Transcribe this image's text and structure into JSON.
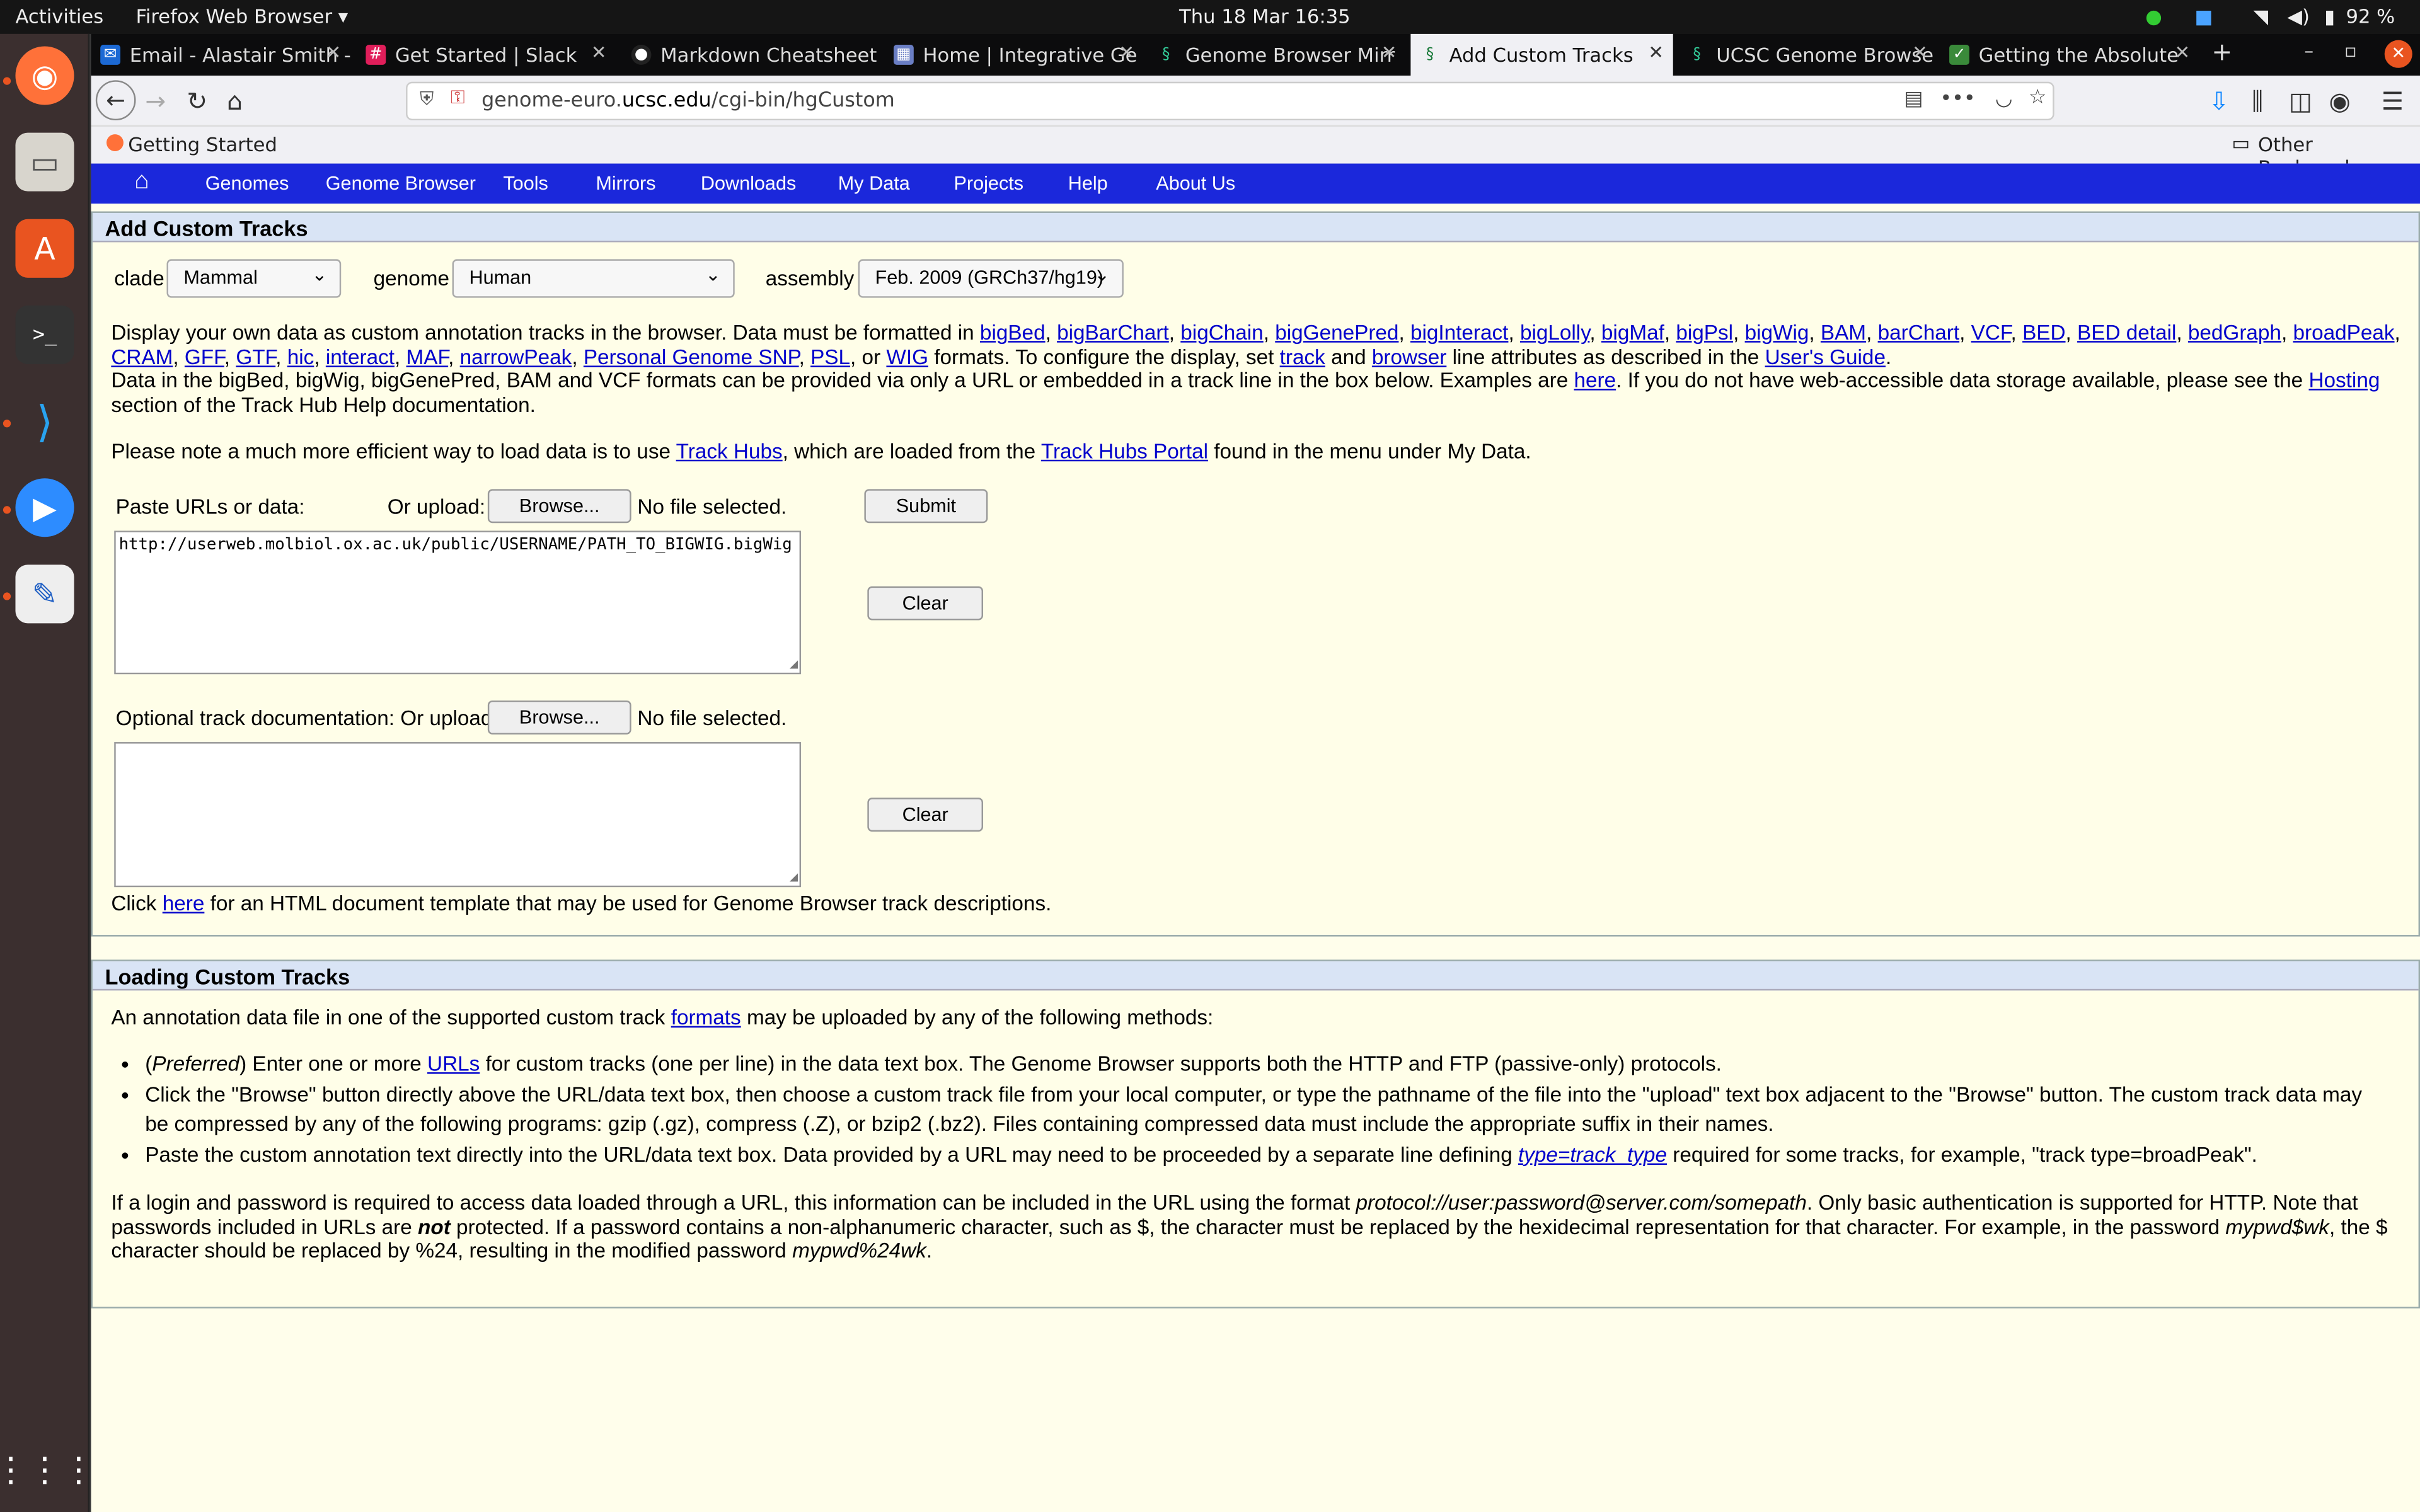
{
  "system": {
    "activities": "Activities",
    "app_menu": "Firefox Web Browser ▾",
    "clock": "Thu 18 Mar  16:35",
    "battery": "92 %"
  },
  "tabs": [
    {
      "label": "Email - Alastair Smith -",
      "icon": "mail-icon"
    },
    {
      "label": "Get Started | Slack",
      "icon": "slack-icon"
    },
    {
      "label": "Markdown Cheatsheet",
      "icon": "github-icon"
    },
    {
      "label": "Home | Integrative Ge",
      "icon": "home-page-icon"
    },
    {
      "label": "Genome Browser Mirr",
      "icon": "ucsc-icon"
    },
    {
      "label": "Add Custom Tracks",
      "icon": "ucsc-icon"
    },
    {
      "label": "UCSC Genome Browse",
      "icon": "ucsc-icon"
    },
    {
      "label": "Getting the Absolute",
      "icon": "page-icon"
    }
  ],
  "browser": {
    "url_host": "genome-euro.",
    "url_domain": "ucsc.edu",
    "url_path": "/cgi-bin/hgCustom",
    "bookmark": "Getting Started",
    "other_bookmarks": "Other Bookmarks"
  },
  "menu": [
    "Genomes",
    "Genome Browser",
    "Tools",
    "Mirrors",
    "Downloads",
    "My Data",
    "Projects",
    "Help",
    "About Us"
  ],
  "add": {
    "title": "Add Custom Tracks",
    "clade_label": "clade",
    "clade": "Mammal",
    "genome_label": "genome",
    "genome": "Human",
    "assembly_label": "assembly",
    "assembly": "Feb. 2009 (GRCh37/hg19)",
    "intro1": "Display your own data as custom annotation tracks in the browser. Data must be formatted in",
    "formats": [
      "bigBed",
      "bigBarChart",
      "bigChain",
      "bigGenePred",
      "bigInteract",
      "bigLolly",
      "bigMaf",
      "bigPsl",
      "bigWig",
      "BAM",
      "barChart",
      "VCF",
      "BED",
      "BED detail",
      "bedGraph",
      "broadPeak",
      "CRAM",
      "GFF",
      "GTF",
      "hic",
      "interact",
      "MAF",
      "narrowPeak",
      "Personal Genome SNP",
      "PSL"
    ],
    "or": ", or",
    "wig": "WIG",
    "intro2": "formats. To configure the display, set",
    "track": "track",
    "and": "and",
    "browser_link": "browser",
    "intro3": "line attributes as described in the",
    "guide": "User's Guide",
    "intro4": "Data in the bigBed, bigWig, bigGenePred, BAM and VCF formats can be provided via only a URL or embedded in a track line in the box below. Examples are",
    "here": "here",
    "intro5": ". If you do not have web-accessible data storage available, please see the",
    "hosting": "Hosting",
    "intro6": "section of the Track Hub Help documentation.",
    "note1": "Please note a much more efficient way to load data is to use",
    "track_hubs": "Track Hubs",
    "note2": ", which are loaded from the",
    "portal": "Track Hubs Portal",
    "note3": "found in the menu under My Data.",
    "paste_label": "Paste URLs or data:",
    "upload_label": "Or upload:",
    "browse": "Browse...",
    "no_file": "No file selected.",
    "submit": "Submit",
    "clear": "Clear",
    "textarea_value": "http://userweb.molbiol.ox.ac.uk/public/USERNAME/PATH_TO_BIGWIG.bigWig",
    "doc_label": "Optional track documentation: Or upload:",
    "click": "Click",
    "click_here": "here",
    "click_rest": "for an HTML document template that may be used for Genome Browser track descriptions."
  },
  "load": {
    "title": "Loading Custom Tracks",
    "intro": "An annotation data file in one of the supported custom track",
    "formats": "formats",
    "intro2": "may be uploaded by any of the following methods:",
    "b1a": "(",
    "b1i": "Preferred",
    "b1b": ") Enter one or more",
    "urls": "URLs",
    "b1c": "for custom tracks (one per line) in the data text box. The Genome Browser supports both the HTTP and FTP (passive-only) protocols.",
    "b2": "Click the \"Browse\" button directly above the URL/data text box, then choose a custom track file from your local computer, or type the pathname of the file into the \"upload\" text box adjacent to the \"Browse\" button. The custom track data may be compressed by any of the following programs: gzip (.gz), compress (.Z), or bzip2 (.bz2). Files containing compressed data must include the appropriate suffix in their names.",
    "b3a": "Paste the custom annotation text directly into the URL/data text box. Data provided by a URL may need to be proceeded by a separate line defining",
    "type": "type=track_type",
    "b3b": "required for some tracks, for example, \"track type=broadPeak\".",
    "p1": "If a login and password is required to access data loaded through a URL, this information can be included in the URL using the format",
    "proto": "protocol://user:password@server.com/somepath",
    "p2": ". Only basic authentication is supported for HTTP. Note that passwords included in URLs are",
    "not": "not",
    "p3": "protected. If a password contains a non-alphanumeric character, such as $, the character must be replaced by the hexidecimal representation for that character. For example, in the password",
    "pw1": "mypwd$wk",
    "p4": ", the $ character should be replaced by %24, resulting in the modified password",
    "pw2": "mypwd%24wk",
    "p5": "."
  }
}
